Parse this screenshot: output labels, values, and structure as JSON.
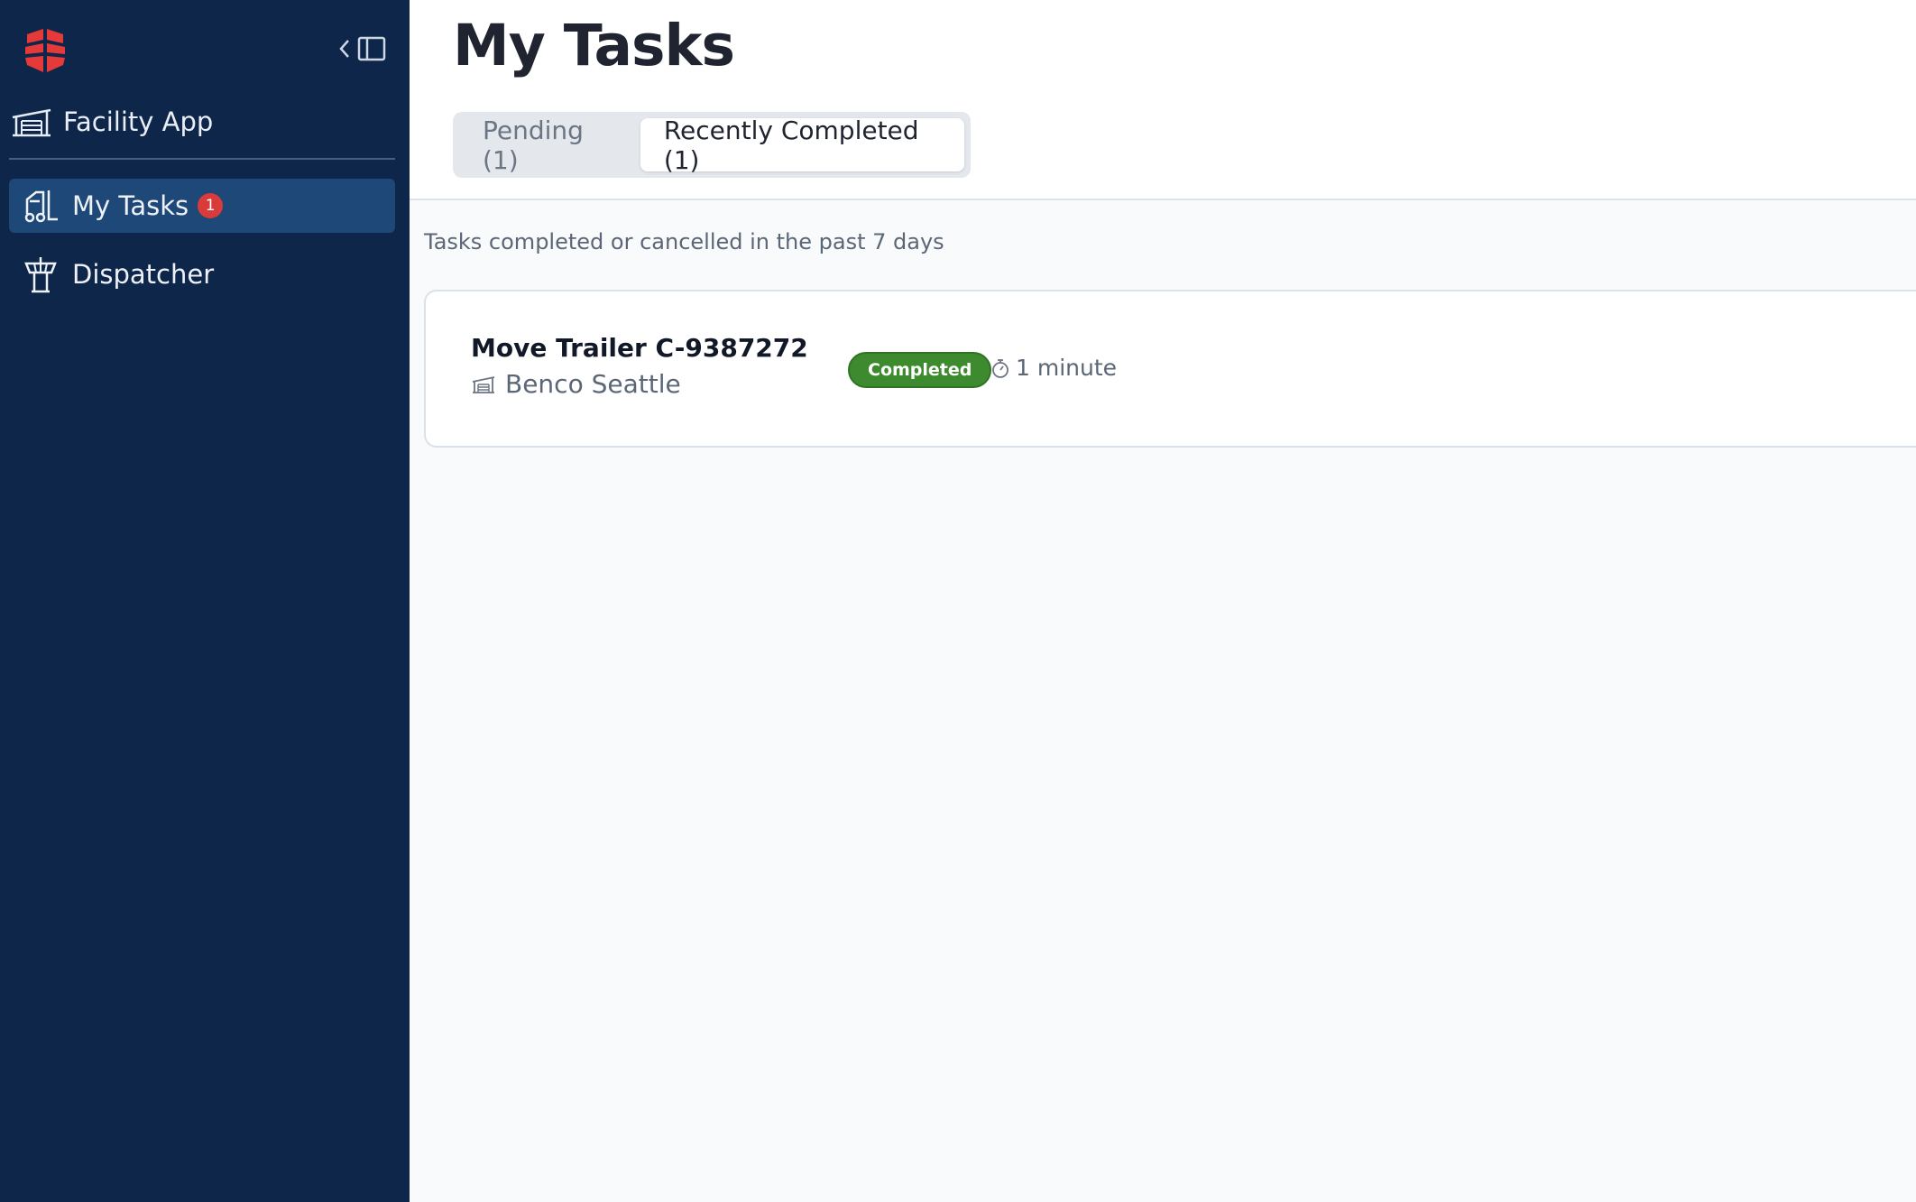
{
  "sidebar": {
    "app_name": "Facility App",
    "nav": [
      {
        "label": "My Tasks",
        "badge": "1",
        "icon": "forklift-icon",
        "active": true
      },
      {
        "label": "Dispatcher",
        "icon": "control-tower-icon",
        "active": false
      }
    ]
  },
  "header": {
    "title": "My Tasks",
    "tabs": [
      {
        "label": "Pending (1)",
        "selected": false
      },
      {
        "label": "Recently Completed (1)",
        "selected": true
      }
    ]
  },
  "content": {
    "subtitle": "Tasks completed or cancelled in the past 7 days",
    "tasks": [
      {
        "title": "Move Trailer C-9387272",
        "location": "Benco Seattle",
        "status": "Completed",
        "duration": "1 minute"
      }
    ]
  },
  "colors": {
    "sidebar_bg": "#0e2649",
    "active_nav_bg": "#1e4878",
    "badge": "#d93a3a",
    "brand": "#e63a3a",
    "status_completed": "#3d8b2e"
  }
}
